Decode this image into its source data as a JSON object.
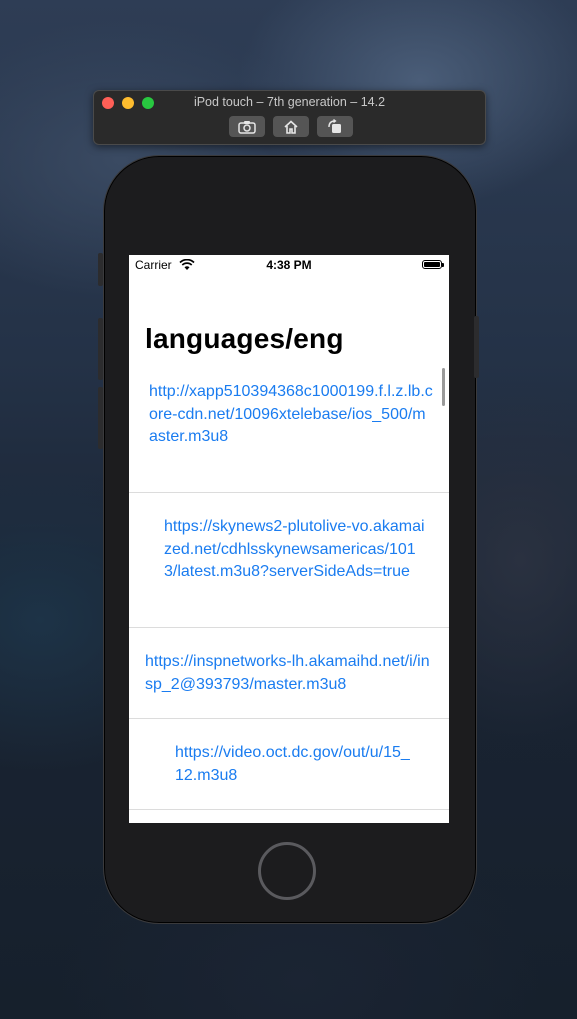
{
  "simulator": {
    "title": "iPod touch – 7th generation – 14.2",
    "buttons": [
      "screenshot-icon",
      "home-icon",
      "rotate-icon"
    ]
  },
  "status_bar": {
    "carrier": "Carrier",
    "time": "4:38 PM"
  },
  "nav": {
    "title": "languages/eng"
  },
  "list": {
    "items": [
      {
        "url": "http://xapp510394368c1000199.f.l.z.lb.core-cdn.net/10096xtelebase/ios_500/master.m3u8"
      },
      {
        "url": "https://skynews2-plutolive-vo.akamaized.net/cdhlsskynewsamericas/1013/latest.m3u8?serverSideAds=true"
      },
      {
        "url": "https://inspnetworks-lh.akamaihd.net/i/insp_2@393793/master.m3u8"
      },
      {
        "url": "https://video.oct.dc.gov/out/u/15_12.m3u8"
      }
    ]
  },
  "colors": {
    "link": "#1a7cf0",
    "separator": "#dcdcdc",
    "device": "#1c1c1e"
  }
}
